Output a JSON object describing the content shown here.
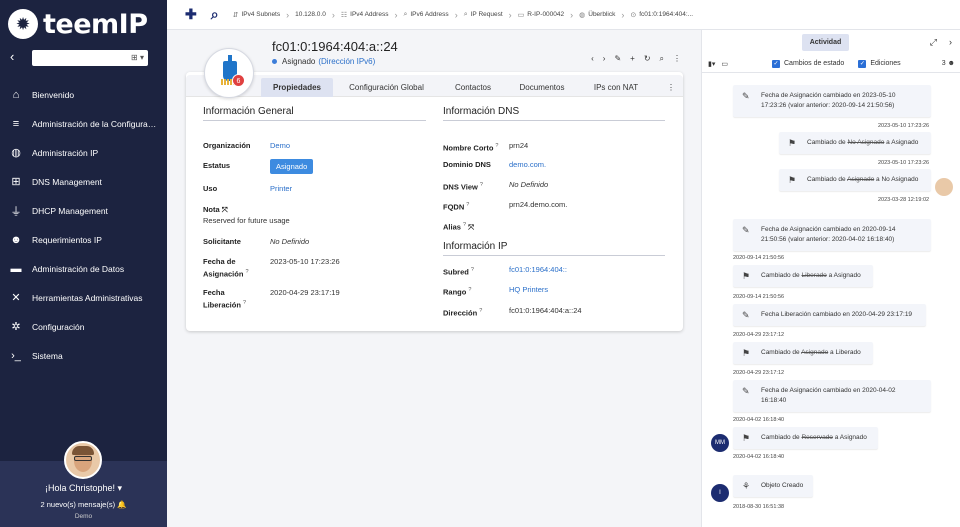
{
  "app": {
    "logo_text": "teemIP"
  },
  "sidebar": {
    "search_value": "",
    "items": [
      {
        "icon": "home-icon",
        "glyph": "⌂",
        "label": "Bienvenido"
      },
      {
        "icon": "database-icon",
        "glyph": "≡",
        "label": "Administración de la Configura…"
      },
      {
        "icon": "globe-icon",
        "glyph": "◍",
        "label": "Administración IP"
      },
      {
        "icon": "sitemap-icon",
        "glyph": "⊞",
        "label": "DNS Management"
      },
      {
        "icon": "plug-icon",
        "glyph": "⏚",
        "label": "DHCP Management"
      },
      {
        "icon": "users-icon",
        "glyph": "☻",
        "label": "Requerimientos IP"
      },
      {
        "icon": "folder-icon",
        "glyph": "▬",
        "label": "Administración de Datos"
      },
      {
        "icon": "tools-icon",
        "glyph": "✕",
        "label": "Herramientas Administrativas"
      },
      {
        "icon": "gear-icon",
        "glyph": "✲",
        "label": "Configuración"
      },
      {
        "icon": "terminal-icon",
        "glyph": "›_",
        "label": "Sistema"
      }
    ],
    "user": {
      "greeting": "¡Hola Christophe!",
      "messages": "2 nuevo(s) mensaje(s)",
      "org": "Demo"
    }
  },
  "topbar": {
    "breadcrumbs": [
      {
        "icon": "subnet-icon",
        "glyph": "⇵",
        "label": "IPv4 Subnets"
      },
      {
        "icon": "",
        "glyph": "",
        "label": "10.128.0.0"
      },
      {
        "icon": "list-icon",
        "glyph": "☷",
        "label": "IPv4 Address"
      },
      {
        "icon": "search-icon",
        "glyph": "⌕",
        "label": "IPv6 Address"
      },
      {
        "icon": "search-icon",
        "glyph": "⌕",
        "label": "IP Request"
      },
      {
        "icon": "card-icon",
        "glyph": "▭",
        "label": "R-IP-000042"
      },
      {
        "icon": "globe-icon",
        "glyph": "◍",
        "label": "Überblick"
      },
      {
        "icon": "object-icon",
        "glyph": "⊙",
        "label": "fc01:0:1964:404:..."
      }
    ]
  },
  "object": {
    "title": "fc01:0:1964:404:a::24",
    "status": "Asignado",
    "class_link": "(Dirección IPv6)",
    "badge": "6",
    "tabs": [
      "Propiedades",
      "Configuración Global",
      "Contactos",
      "Documentos",
      "IPs con NAT"
    ],
    "general": {
      "title": "Información General",
      "org_label": "Organización",
      "org_value": "Demo",
      "status_label": "Estatus",
      "status_value": "Asignado",
      "use_label": "Uso",
      "use_value": "Printer",
      "note_label": "Nota",
      "note_value": "Reserved for future usage",
      "req_label": "Solicitante",
      "req_value": "No Definido",
      "assign_label_1": "Fecha de",
      "assign_label_2": "Asignación",
      "assign_value": "2023-05-10 17:23:26",
      "release_label_1": "Fecha",
      "release_label_2": "Liberación",
      "release_value": "2020-04-29 23:17:19"
    },
    "dns": {
      "title": "Información DNS",
      "short_label": "Nombre Corto",
      "short_value": "prn24",
      "domain_label": "Dominio DNS",
      "domain_value": "demo.com.",
      "view_label": "DNS View",
      "view_value": "No Definido",
      "fqdn_label": "FQDN",
      "fqdn_value": "prn24.demo.com.",
      "alias_label": "Alias"
    },
    "ip": {
      "title": "Información IP",
      "subnet_label": "Subred",
      "subnet_value": "fc01:0:1964:404::",
      "range_label": "Rango",
      "range_value": "HQ Printers",
      "address_label": "Dirección",
      "address_value": "fc01:0:1964:404:a::24"
    }
  },
  "activity": {
    "tab": "Actividad",
    "filter_state": "Cambios de estado",
    "filter_edits": "Ediciones",
    "user_count": "3",
    "entries": [
      {
        "line1": "Fecha de Asignación cambiado en 2023-05-10",
        "line2": "17:23:26 (valor anterior: 2020-09-14 21:50:56)",
        "ts": "2023-05-10 17:23:26"
      },
      {
        "pre": "Cambiado de ",
        "old": "No Asignado",
        "post": " a Asignado",
        "ts": "2023-05-10 17:23:26"
      },
      {
        "pre": "Cambiado de ",
        "old": "Asignado",
        "post": " a No Asignado",
        "ts": "2023-03-28 12:19:02"
      },
      {
        "line1": "Fecha de Asignación cambiado en 2020-09-14",
        "line2": "21:50:56 (valor anterior: 2020-04-02 16:18:40)",
        "ts": "2020-09-14 21:50:56"
      },
      {
        "pre": "Cambiado de ",
        "old": "Liberado",
        "post": " a Asignado",
        "ts": "2020-09-14 21:50:56"
      },
      {
        "line1": "Fecha Liberación cambiado en 2020-04-29 23:17:19",
        "ts": "2020-04-29 23:17:12"
      },
      {
        "pre": "Cambiado de ",
        "old": "Asignado",
        "post": " a Liberado",
        "ts": "2020-04-29 23:17:12"
      },
      {
        "line1": "Fecha de Asignación cambiado en 2020-04-02",
        "line2": "16:18:40",
        "ts": "2020-04-02 16:18:40"
      },
      {
        "pre": "Cambiado de ",
        "old": "Reservado",
        "post": " a Asignado",
        "ts": "2020-04-02 16:18:40",
        "avatar": "MM"
      },
      {
        "line1": "Objeto Creado",
        "ts": "2018-08-30 16:51:38",
        "avatar": "I"
      }
    ]
  }
}
